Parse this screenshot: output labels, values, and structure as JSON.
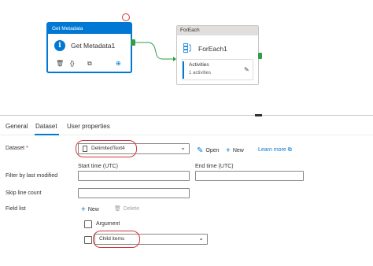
{
  "canvas": {
    "get_metadata": {
      "header": "Get Metadata",
      "name": "Get Metadata1",
      "action_icons": [
        "delete-icon",
        "code-icon",
        "copy-icon",
        "go-icon"
      ]
    },
    "foreach": {
      "header": "ForEach",
      "name": "ForEach1",
      "activities_label": "Activities",
      "activities_count": "1 activities"
    }
  },
  "tabs": [
    {
      "label": "General"
    },
    {
      "label": "Dataset"
    },
    {
      "label": "User properties"
    }
  ],
  "form": {
    "dataset": {
      "label": "Dataset",
      "required_mark": "*",
      "value": "DelimitedText4",
      "open_label": "Open",
      "new_label": "New",
      "learn_more_label": "Learn more"
    },
    "filter": {
      "label": "Filter by last modified",
      "start_label": "Start time (UTC)",
      "end_label": "End time (UTC)"
    },
    "skip_line_count": {
      "label": "Skip line count"
    },
    "field_list": {
      "label": "Field list",
      "new_label": "New",
      "delete_label": "Delete",
      "argument_label": "Argument",
      "selected": "Child items"
    }
  },
  "colors": {
    "accent": "#0078d4",
    "success": "#2f9e44",
    "annotation": "#d13438"
  }
}
